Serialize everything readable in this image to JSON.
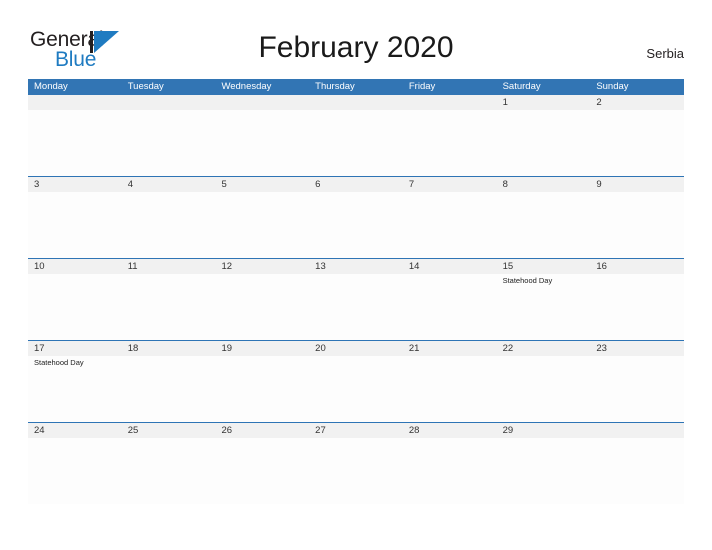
{
  "brand": {
    "name_part1": "General",
    "name_part2": "Blue",
    "triangle_color": "#1f7bc1"
  },
  "header": {
    "title": "February 2020",
    "region": "Serbia",
    "header_bg_color": "#3275b4",
    "row_strip_color": "#f1f1f1",
    "row_border_color": "#2e74b5"
  },
  "weekdays": [
    "Monday",
    "Tuesday",
    "Wednesday",
    "Thursday",
    "Friday",
    "Saturday",
    "Sunday"
  ],
  "weeks": [
    {
      "days": [
        {
          "num": "",
          "events": []
        },
        {
          "num": "",
          "events": []
        },
        {
          "num": "",
          "events": []
        },
        {
          "num": "",
          "events": []
        },
        {
          "num": "",
          "events": []
        },
        {
          "num": "1",
          "events": []
        },
        {
          "num": "2",
          "events": []
        }
      ]
    },
    {
      "days": [
        {
          "num": "3",
          "events": []
        },
        {
          "num": "4",
          "events": []
        },
        {
          "num": "5",
          "events": []
        },
        {
          "num": "6",
          "events": []
        },
        {
          "num": "7",
          "events": []
        },
        {
          "num": "8",
          "events": []
        },
        {
          "num": "9",
          "events": []
        }
      ]
    },
    {
      "days": [
        {
          "num": "10",
          "events": []
        },
        {
          "num": "11",
          "events": []
        },
        {
          "num": "12",
          "events": []
        },
        {
          "num": "13",
          "events": []
        },
        {
          "num": "14",
          "events": []
        },
        {
          "num": "15",
          "events": [
            "Statehood Day"
          ]
        },
        {
          "num": "16",
          "events": []
        }
      ]
    },
    {
      "days": [
        {
          "num": "17",
          "events": [
            "Statehood Day"
          ]
        },
        {
          "num": "18",
          "events": []
        },
        {
          "num": "19",
          "events": []
        },
        {
          "num": "20",
          "events": []
        },
        {
          "num": "21",
          "events": []
        },
        {
          "num": "22",
          "events": []
        },
        {
          "num": "23",
          "events": []
        }
      ]
    },
    {
      "days": [
        {
          "num": "24",
          "events": []
        },
        {
          "num": "25",
          "events": []
        },
        {
          "num": "26",
          "events": []
        },
        {
          "num": "27",
          "events": []
        },
        {
          "num": "28",
          "events": []
        },
        {
          "num": "29",
          "events": []
        },
        {
          "num": "",
          "events": []
        }
      ]
    }
  ]
}
